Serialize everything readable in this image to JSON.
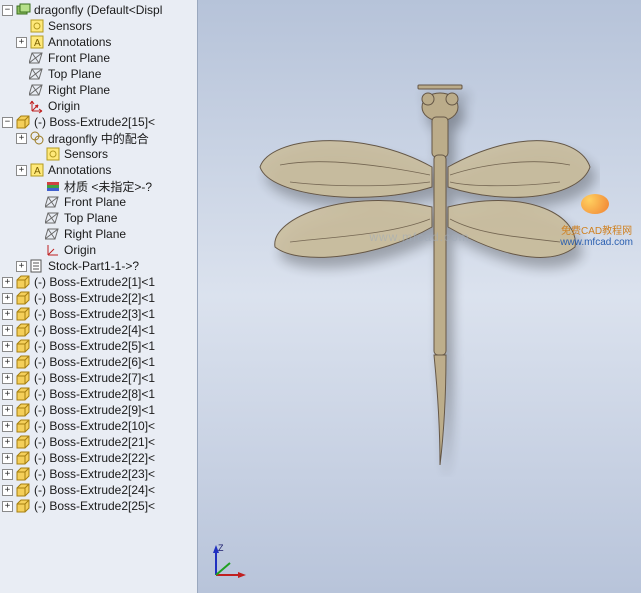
{
  "root": {
    "label": "dragonfly  (Default<Displ",
    "children": {
      "sensors": "Sensors",
      "annotations": "Annotations",
      "front_plane": "Front Plane",
      "top_plane": "Top Plane",
      "right_plane": "Right Plane",
      "origin": "Origin"
    }
  },
  "feat15": {
    "label": "(-) Boss-Extrude2[15]<",
    "children": {
      "mates": "dragonfly 中的配合",
      "sensors": "Sensors",
      "annotations": "Annotations",
      "material": "材质 <未指定>-?",
      "front_plane": "Front Plane",
      "top_plane": "Top Plane",
      "right_plane": "Right Plane",
      "origin": "Origin",
      "stock": "Stock-Part1-1->?"
    }
  },
  "feats": [
    "(-) Boss-Extrude2[1]<1",
    "(-) Boss-Extrude2[2]<1",
    "(-) Boss-Extrude2[3]<1",
    "(-) Boss-Extrude2[4]<1",
    "(-) Boss-Extrude2[5]<1",
    "(-) Boss-Extrude2[6]<1",
    "(-) Boss-Extrude2[7]<1",
    "(-) Boss-Extrude2[8]<1",
    "(-) Boss-Extrude2[9]<1",
    "(-) Boss-Extrude2[10]<",
    "(-) Boss-Extrude2[21]<",
    "(-) Boss-Extrude2[22]<",
    "(-) Boss-Extrude2[23]<",
    "(-) Boss-Extrude2[24]<",
    "(-) Boss-Extrude2[25]<"
  ],
  "triad": {
    "x": "",
    "y": "",
    "z": "Z"
  },
  "watermark_center": "www.mfcad.com",
  "watermark_right_text": "免费CAD教程网",
  "watermark_right_url": "www.mfcad.com"
}
